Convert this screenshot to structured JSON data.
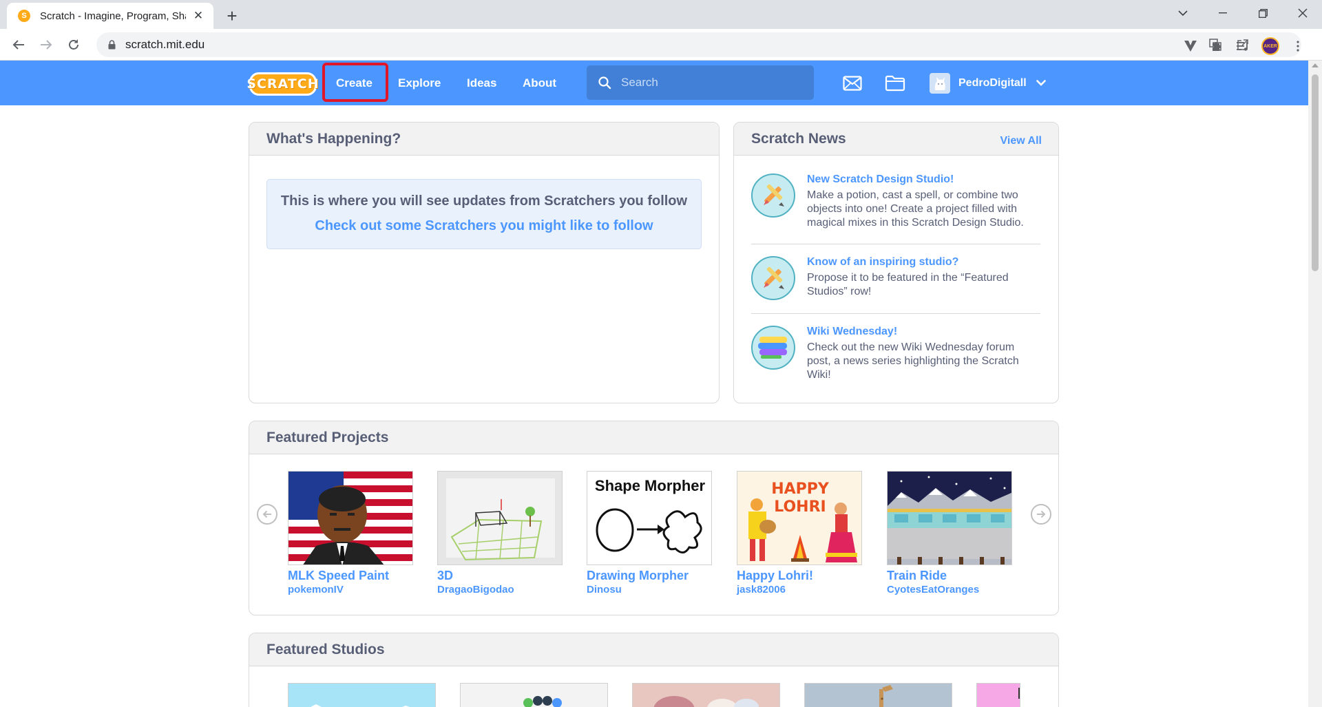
{
  "browser": {
    "tab_title": "Scratch - Imagine, Program, Share",
    "favicon_letter": "S",
    "url": "scratch.mit.edu",
    "icons": [
      "back-icon",
      "forward-icon",
      "reload-icon",
      "lock-icon",
      "translate-icon",
      "share-icon",
      "star-icon",
      "extension-icon",
      "puzzle-icon",
      "media-icon",
      "profile-avatar"
    ],
    "profile_text": "AKER"
  },
  "nav": {
    "logo_text": "SCRATCH",
    "links": [
      "Create",
      "Explore",
      "Ideas",
      "About"
    ],
    "search_placeholder": "Search",
    "username": "PedroDigitall",
    "accent": "#4c97ff",
    "highlight_color": "#e0162b"
  },
  "happening": {
    "title": "What's Happening?",
    "message": "This is where you will see updates from Scratchers you follow",
    "link": "Check out some Scratchers you might like to follow"
  },
  "news": {
    "title": "Scratch News",
    "view_all": "View All",
    "items": [
      {
        "title": "New Scratch Design Studio!",
        "body": "Make a potion, cast a spell, or combine two objects into one! Create a project filled with magical mixes in this Scratch Design Studio.",
        "icon": "paintbrush-pencil-icon"
      },
      {
        "title": "Know of an inspiring studio?",
        "body": "Propose it to be featured in the “Featured Studios” row!",
        "icon": "paintbrush-pencil-icon"
      },
      {
        "title": "Wiki Wednesday!",
        "body": "Check out the new Wiki Wednesday forum post, a news series highlighting the Scratch Wiki!",
        "icon": "wiki-stripes-icon"
      }
    ]
  },
  "featured_projects": {
    "title": "Featured Projects",
    "thumb_texts": [
      "Shape Morpher",
      "HAPPY",
      "LOHRI"
    ],
    "items": [
      {
        "title": "MLK Speed Paint",
        "author": "pokemonIV"
      },
      {
        "title": "3D",
        "author": "DragaoBigodao"
      },
      {
        "title": "Drawing Morpher",
        "author": "Dinosu"
      },
      {
        "title": "Happy Lohri!",
        "author": "jask82006"
      },
      {
        "title": "Train Ride",
        "author": "CyotesEatOranges"
      }
    ]
  },
  "featured_studios": {
    "title": "Featured Studios"
  }
}
